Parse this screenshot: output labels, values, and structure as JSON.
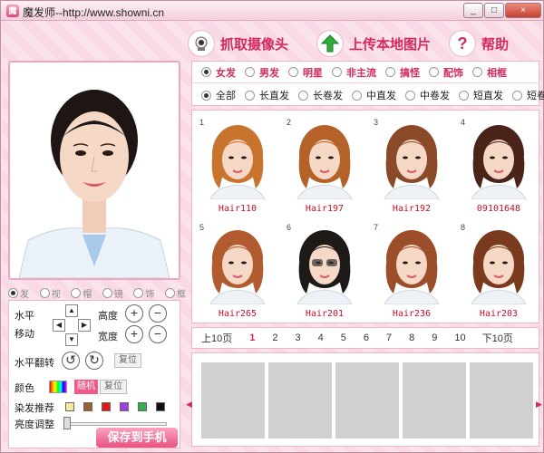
{
  "window": {
    "title": "魔发师--http://www.showni.cn",
    "icon_glyph": "魔",
    "controls": [
      "_",
      "□",
      "×"
    ]
  },
  "toolbar": {
    "camera": {
      "label": "抓取摄像头",
      "icon": "camera-icon"
    },
    "upload": {
      "label": "上传本地图片",
      "icon": "upload-arrow-icon"
    },
    "help": {
      "label": "帮助",
      "glyph": "?"
    }
  },
  "photo_options": [
    {
      "label": "发",
      "selected": true
    },
    {
      "label": "视",
      "selected": false
    },
    {
      "label": "帽",
      "selected": false
    },
    {
      "label": "镜",
      "selected": false
    },
    {
      "label": "饰",
      "selected": false
    },
    {
      "label": "框",
      "selected": false
    }
  ],
  "controls": {
    "horizontal_label": "水平",
    "move_label": "移动",
    "height_label": "高度",
    "width_label": "宽度",
    "flip_label": "水平翻转",
    "reset1": "复位",
    "color_label": "颜色",
    "random": "随机",
    "reset2": "复位",
    "dye_label": "染发推荐",
    "brightness_label": "亮度调整",
    "save": "保存到手机",
    "dpad": [
      "▲",
      "◀",
      "▶",
      "▼"
    ],
    "plus": "+",
    "minus": "−",
    "rotate_left": "↺",
    "rotate_right": "↻"
  },
  "dye_colors": [
    "#f3ec9a",
    "#9a6233",
    "#e01a1a",
    "#a13de0",
    "#2fb04a",
    "#111111"
  ],
  "categories_row1": [
    {
      "label": "女发",
      "selected": true
    },
    {
      "label": "男发",
      "selected": false
    },
    {
      "label": "明星",
      "selected": false
    },
    {
      "label": "非主流",
      "selected": false
    },
    {
      "label": "搞怪",
      "selected": false
    },
    {
      "label": "配饰",
      "selected": false
    },
    {
      "label": "相框",
      "selected": false
    }
  ],
  "categories_row2": [
    {
      "label": "全部",
      "selected": true
    },
    {
      "label": "长直发",
      "selected": false
    },
    {
      "label": "长卷发",
      "selected": false
    },
    {
      "label": "中直发",
      "selected": false
    },
    {
      "label": "中卷发",
      "selected": false
    },
    {
      "label": "短直发",
      "selected": false
    },
    {
      "label": "短卷发",
      "selected": false
    }
  ],
  "hairstyles": [
    {
      "num": "1",
      "name": "Hair110",
      "color": "#c8742e"
    },
    {
      "num": "2",
      "name": "Hair197",
      "color": "#b5622a"
    },
    {
      "num": "3",
      "name": "Hair192",
      "color": "#8a4a28"
    },
    {
      "num": "4",
      "name": "09101648",
      "color": "#4a2418"
    },
    {
      "num": "5",
      "name": "Hair265",
      "color": "#b25a30"
    },
    {
      "num": "6",
      "name": "Hair201",
      "color": "#1e1a18"
    },
    {
      "num": "7",
      "name": "Hair236",
      "color": "#9c4e2a"
    },
    {
      "num": "8",
      "name": "Hair203",
      "color": "#7a3a1e"
    }
  ],
  "pager": {
    "prev": "上10页",
    "next": "下10页",
    "pages": [
      "1",
      "2",
      "3",
      "4",
      "5",
      "6",
      "7",
      "8",
      "9",
      "10"
    ],
    "current": "1"
  },
  "slots": 5,
  "side_arrows": {
    "left": "◀",
    "right": "▶"
  }
}
